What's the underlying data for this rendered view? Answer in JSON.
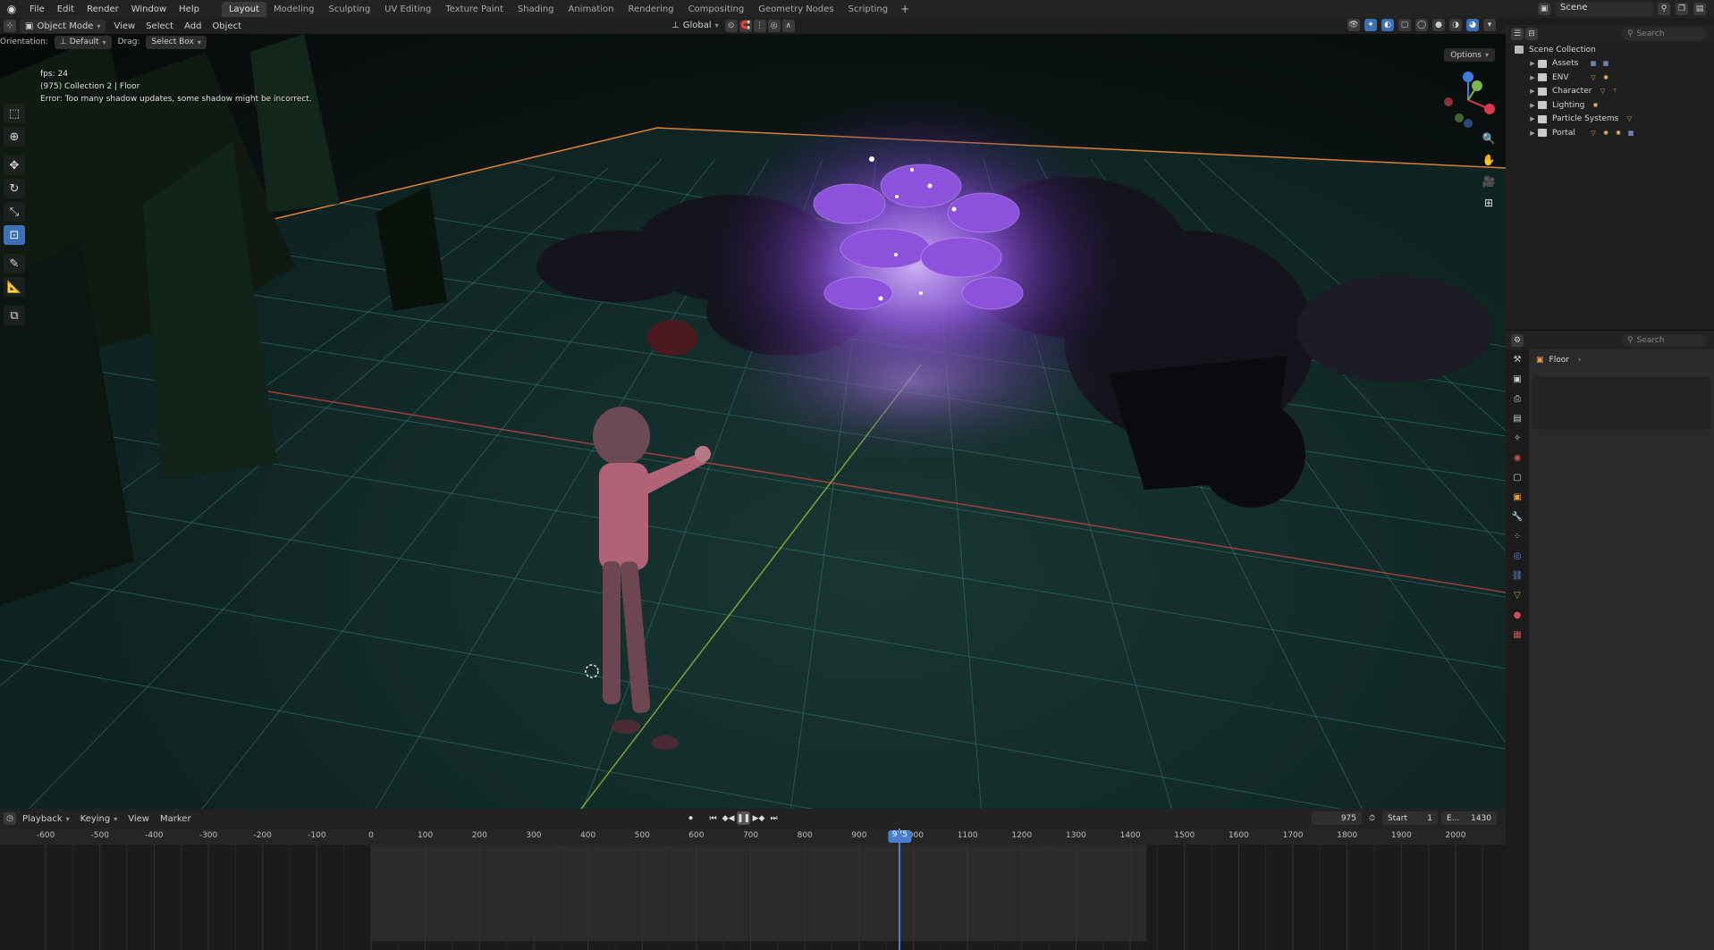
{
  "topbar": {
    "menus": [
      "File",
      "Edit",
      "Render",
      "Window",
      "Help"
    ],
    "workspaces": [
      "Layout",
      "Modeling",
      "Sculpting",
      "UV Editing",
      "Texture Paint",
      "Shading",
      "Animation",
      "Rendering",
      "Compositing",
      "Geometry Nodes",
      "Scripting"
    ],
    "active_workspace": "Layout",
    "plus": "+",
    "scene_label": "Scene"
  },
  "viewport_header": {
    "mode": "Object Mode",
    "menus": [
      "View",
      "Select",
      "Add",
      "Object"
    ],
    "transform_orientation": "Global",
    "options_label": "Options"
  },
  "orient_row": {
    "orientation_label": "Orientation:",
    "orientation_value": "Default",
    "drag_label": "Drag:",
    "drag_value": "Select Box"
  },
  "overlay": {
    "fps": "fps: 24",
    "object_info": "(975) Collection 2 | Floor",
    "error": "Error: Too many shadow updates, some shadow might be incorrect."
  },
  "timeline": {
    "menus": [
      "Playback",
      "Keying",
      "View",
      "Marker"
    ],
    "current_frame": "975",
    "start_label": "Start",
    "start_value": "1",
    "end_label": "E...",
    "end_value": "1430",
    "ticks": [
      "-600",
      "-500",
      "-400",
      "-300",
      "-200",
      "-100",
      "0",
      "100",
      "200",
      "300",
      "400",
      "500",
      "600",
      "700",
      "800",
      "900",
      "1000",
      "1100",
      "1200",
      "1300",
      "1400",
      "1500",
      "1600",
      "1700",
      "1800",
      "1900",
      "2000"
    ],
    "ruler_current": "975"
  },
  "outliner": {
    "search_placeholder": "Search",
    "root": "Scene Collection",
    "collections": [
      {
        "name": "Assets"
      },
      {
        "name": "ENV"
      },
      {
        "name": "Character"
      },
      {
        "name": "Lighting"
      },
      {
        "name": "Particle Systems"
      },
      {
        "name": "Portal"
      }
    ]
  },
  "properties": {
    "search_placeholder": "Search",
    "breadcrumb": "Floor"
  },
  "colors": {
    "accent": "#4a7fd0",
    "portal_glow": "#9a5cf0",
    "floor_grid": "#3f8c83",
    "x_axis": "#c74848",
    "y_axis": "#9bbd3d",
    "boundary": "#d9803a"
  }
}
